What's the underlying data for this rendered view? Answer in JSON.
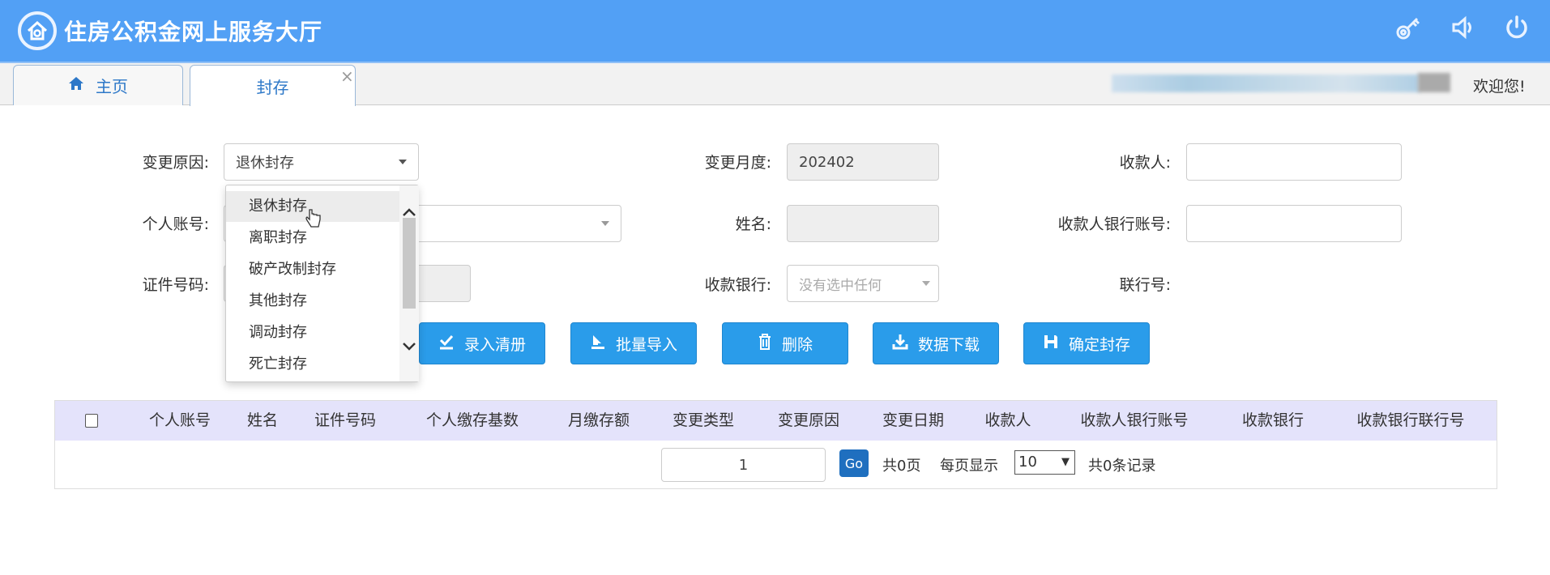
{
  "header": {
    "title": "住房公积金网上服务大厅",
    "icons": [
      "key-icon",
      "speaker-icon",
      "power-icon"
    ],
    "color": "#52a0f5"
  },
  "tabs": [
    {
      "label": "主页",
      "icon": "home-icon"
    },
    {
      "label": "封存",
      "close": "×"
    }
  ],
  "welcome": "欢迎您!",
  "form": {
    "change_reason": {
      "label": "变更原因:",
      "value": "退休封存"
    },
    "change_month": {
      "label": "变更月度:",
      "value": "202402"
    },
    "payee": {
      "label": "收款人:",
      "value": ""
    },
    "personal_account": {
      "label": "个人账号:",
      "value": ""
    },
    "name": {
      "label": "姓名:",
      "value": ""
    },
    "payee_bank_account": {
      "label": "收款人银行账号:",
      "value": ""
    },
    "id_number": {
      "label": "证件号码:",
      "value": ""
    },
    "payee_bank": {
      "label": "收款银行:",
      "placeholder": "没有选中任何"
    },
    "bank_code": {
      "label": "联行号:"
    }
  },
  "dropdown": {
    "options": [
      "退休封存",
      "离职封存",
      "破产改制封存",
      "其他封存",
      "调动封存",
      "死亡封存"
    ],
    "highlighted": "退休封存"
  },
  "buttons": [
    {
      "label": "录入清册",
      "icon": "check-icon"
    },
    {
      "label": "批量导入",
      "icon": "import-icon"
    },
    {
      "label": "删除",
      "icon": "trash-icon"
    },
    {
      "label": "数据下载",
      "icon": "download-icon"
    },
    {
      "label": "确定封存",
      "icon": "save-icon"
    }
  ],
  "table": {
    "columns": [
      "个人账号",
      "姓名",
      "证件号码",
      "个人缴存基数",
      "月缴存额",
      "变更类型",
      "变更原因",
      "变更日期",
      "收款人",
      "收款人银行账号",
      "收款银行",
      "收款银行联行号"
    ]
  },
  "pagination": {
    "page": "1",
    "go": "Go",
    "total_pages": "共0页",
    "per_page_label": "每页显示",
    "per_page": "10",
    "total_records": "共0条记录"
  }
}
